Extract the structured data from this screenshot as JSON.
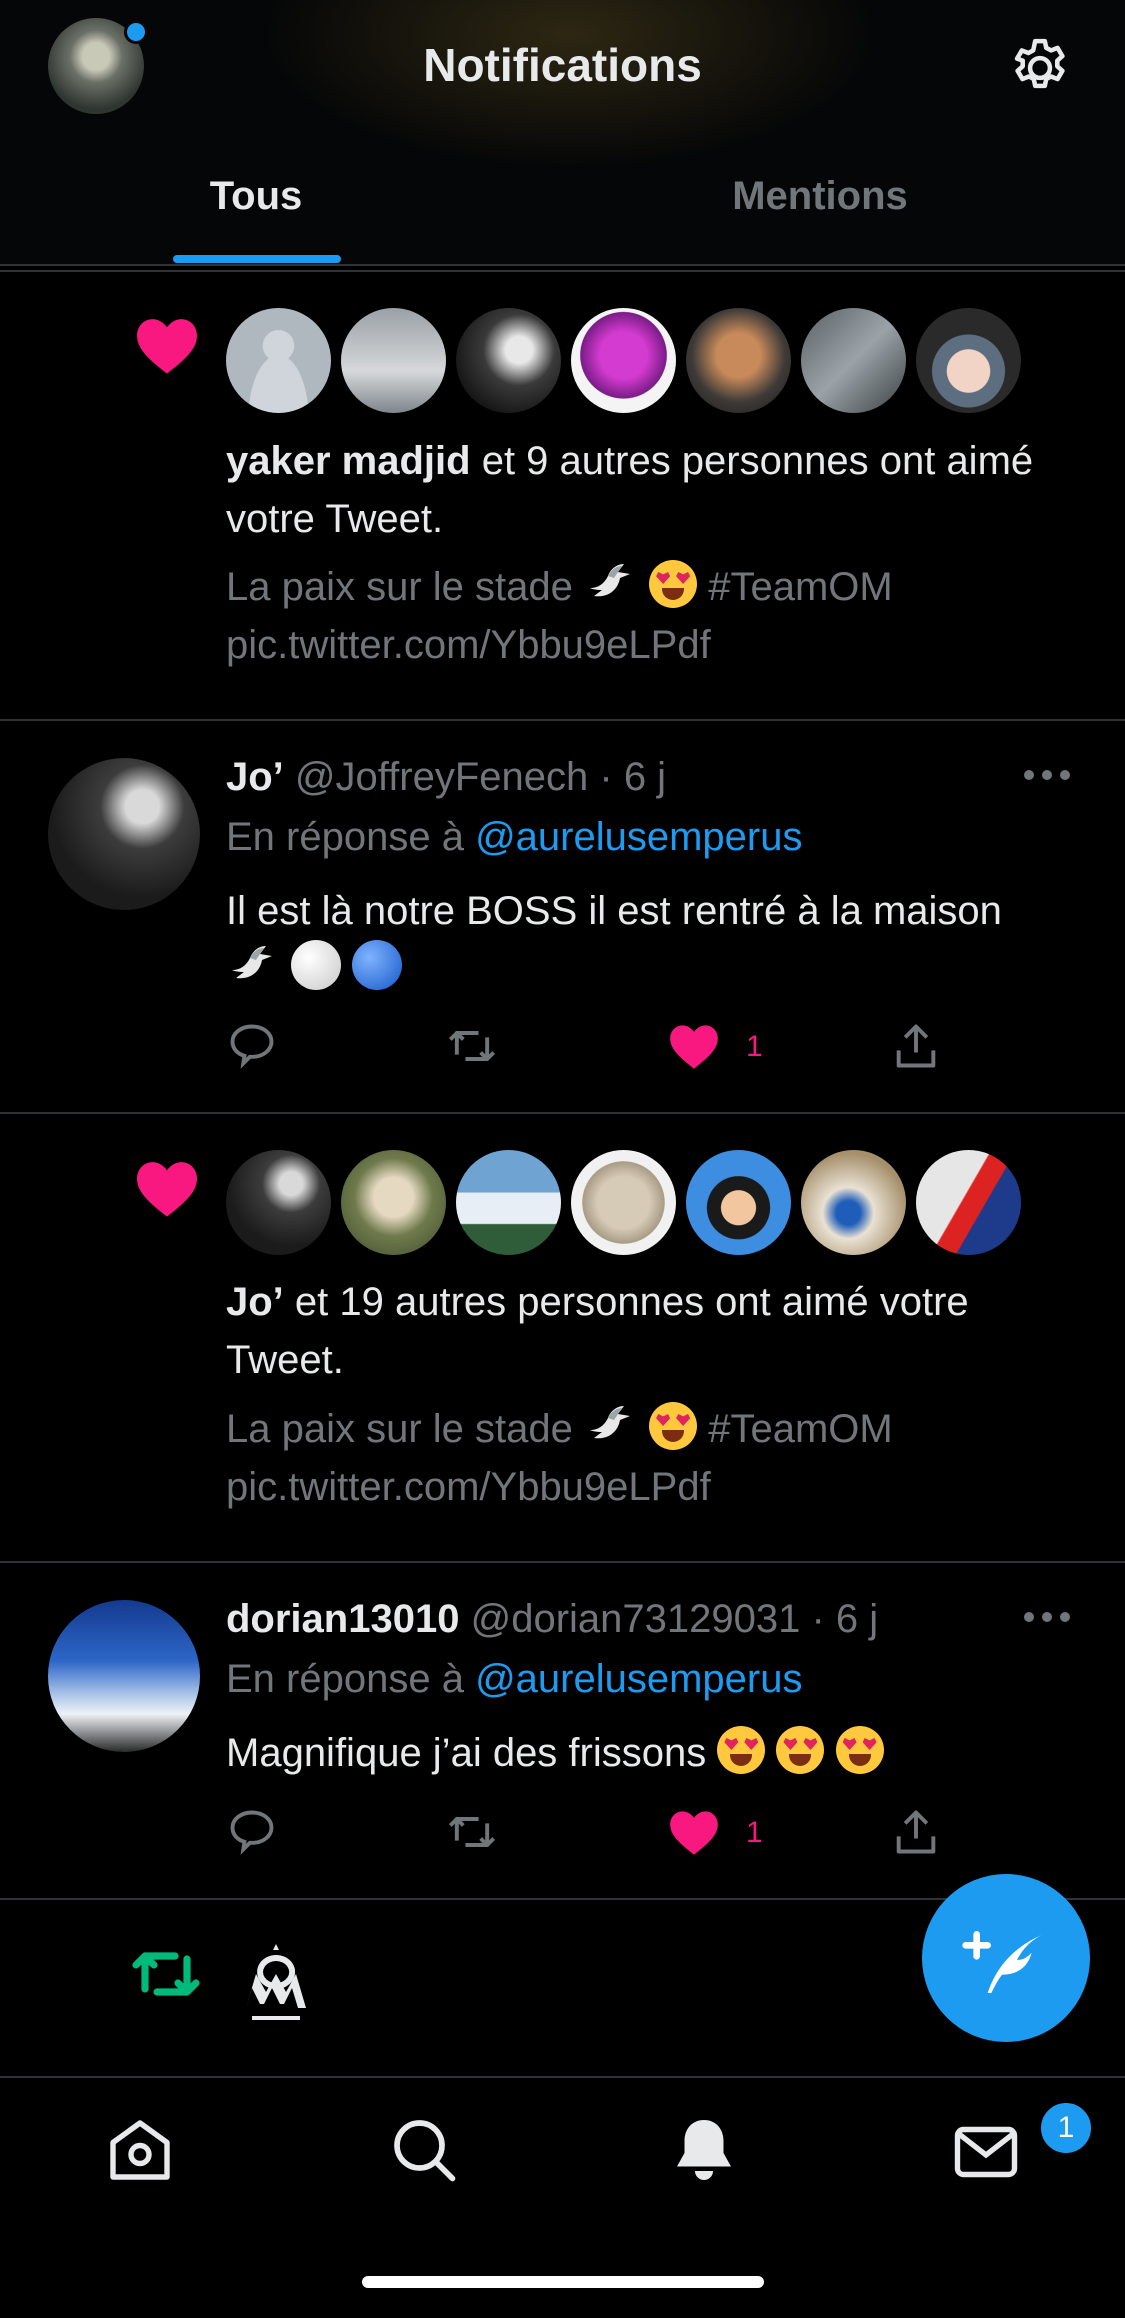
{
  "header": {
    "title": "Notifications",
    "tabs": [
      {
        "label": "Tous",
        "active": true
      },
      {
        "label": "Mentions",
        "active": false
      }
    ],
    "accent": "#1d9bf0"
  },
  "notifications": [
    {
      "type": "like",
      "actor": "yaker madjid",
      "rest": " et 9 autres personnes ont aimé votre Tweet.",
      "tweet_line1": "La paix sur le stade",
      "hashtag": "#TeamOM",
      "tweet_line2": "pic.twitter.com/Ybbu9eLPdf"
    },
    {
      "type": "like",
      "actor": "Jo’",
      "rest": " et 19 autres personnes ont aimé votre Tweet.",
      "tweet_line1": "La paix sur le stade",
      "hashtag": "#TeamOM",
      "tweet_line2": "pic.twitter.com/Ybbu9eLPdf"
    }
  ],
  "tweets": [
    {
      "name": "Jo’",
      "handle": "@JoffreyFenech",
      "time": " · 6 j",
      "reply_prefix": "En réponse à ",
      "reply_to": "@aurelusemperus",
      "body": "Il est là notre BOSS il est rentré à la maison",
      "likes": "1"
    },
    {
      "name": "dorian13010",
      "handle": "@dorian73129031",
      "time": " · 6 j",
      "reply_prefix": "En réponse à ",
      "reply_to": "@aurelusemperus",
      "body": "Magnifique j’ai des frissons",
      "likes": "1"
    }
  ],
  "bottom_nav": {
    "items": [
      "home-icon",
      "search-icon",
      "bell-icon",
      "mail-icon"
    ],
    "mail_badge": "1"
  }
}
